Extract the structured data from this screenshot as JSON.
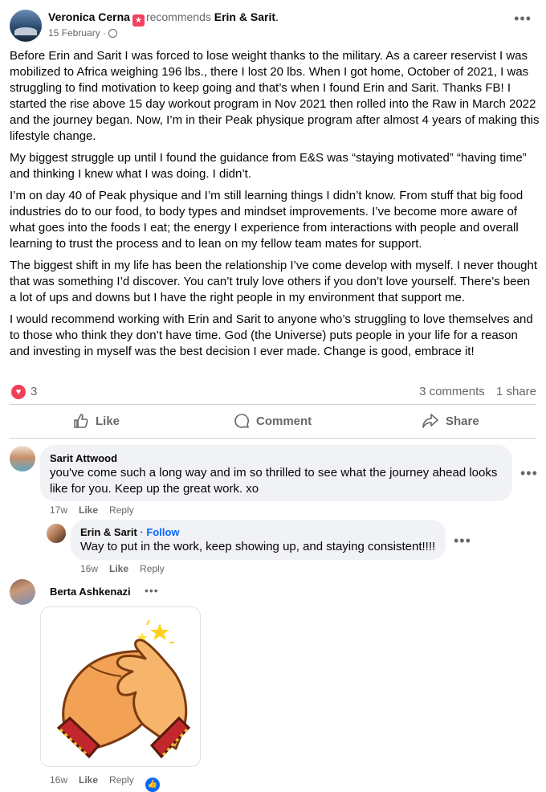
{
  "post": {
    "author": "Veronica Cerna",
    "recommends_text": "recommends",
    "page_name": "Erin & Sarit",
    "page_suffix": ".",
    "date": "15 February",
    "more_label": "•••",
    "paragraphs": [
      "Before Erin and Sarit I was forced to lose weight thanks to the military. As a career reservist I was mobilized to Africa weighing 196 lbs., there I lost 20 lbs. When I got home, October of 2021, I was struggling to find motivation to keep going and that’s when I found Erin and Sarit. Thanks FB! I started the rise above 15 day workout program in Nov 2021 then rolled into the Raw in March 2022 and the journey began. Now, I’m in their Peak physique program after almost 4 years of making this lifestyle change.",
      "My biggest struggle up until I found the guidance from E&S was “staying motivated” “having time” and thinking I knew what I was doing. I didn’t.",
      " I’m on day 40 of Peak physique and I’m still learning things I didn’t know. From stuff that big food industries do to our food, to body types and mindset improvements. I’ve become more aware of what goes into the foods I eat; the energy I experience from interactions with people and overall learning to trust the process and to lean on my fellow team mates for support.",
      "The biggest shift in my life has been the relationship I’ve come develop with myself. I never thought that was something I’d discover. You can’t truly love others if you don’t love yourself. There’s been a lot of ups and downs but I have the right people in my environment that support me.",
      "I would recommend working with Erin and Sarit to anyone who’s struggling to love themselves and to those who think they don’t have time. God (the Universe) puts people in your life for a reason and investing in myself was the best decision I ever made. Change is good, embrace it!"
    ],
    "reaction_count": "3",
    "comments_count": "3 comments",
    "shares_count": "1 share"
  },
  "actions": {
    "like": "Like",
    "comment": "Comment",
    "share": "Share"
  },
  "comments": [
    {
      "author": "Sarit Attwood",
      "text": "you've come such a long way and im so thrilled to see what the journey ahead looks like for you. Keep up the great work. xo",
      "time": "17w",
      "like": "Like",
      "reply": "Reply"
    },
    {
      "author": "Erin & Sarit",
      "follow": "· Follow",
      "text": "Way to put in the work, keep showing up, and staying consistent!!!!",
      "time": "16w",
      "like": "Like",
      "reply": "Reply"
    },
    {
      "author": "Berta Ashkenazi",
      "time": "16w",
      "like": "Like",
      "reply": "Reply"
    }
  ],
  "colors": {
    "accent": "#0866ff",
    "heart": "#f33e58",
    "badge": "#f3425f",
    "bubble": "#f0f2f5",
    "muted": "#65676b"
  },
  "icons": [
    "recommend-badge-icon",
    "globe-icon",
    "heart-reaction-icon",
    "like-icon",
    "comment-icon",
    "share-icon",
    "more-options-icon",
    "like-reaction-icon",
    "clapping-hands-sticker"
  ]
}
